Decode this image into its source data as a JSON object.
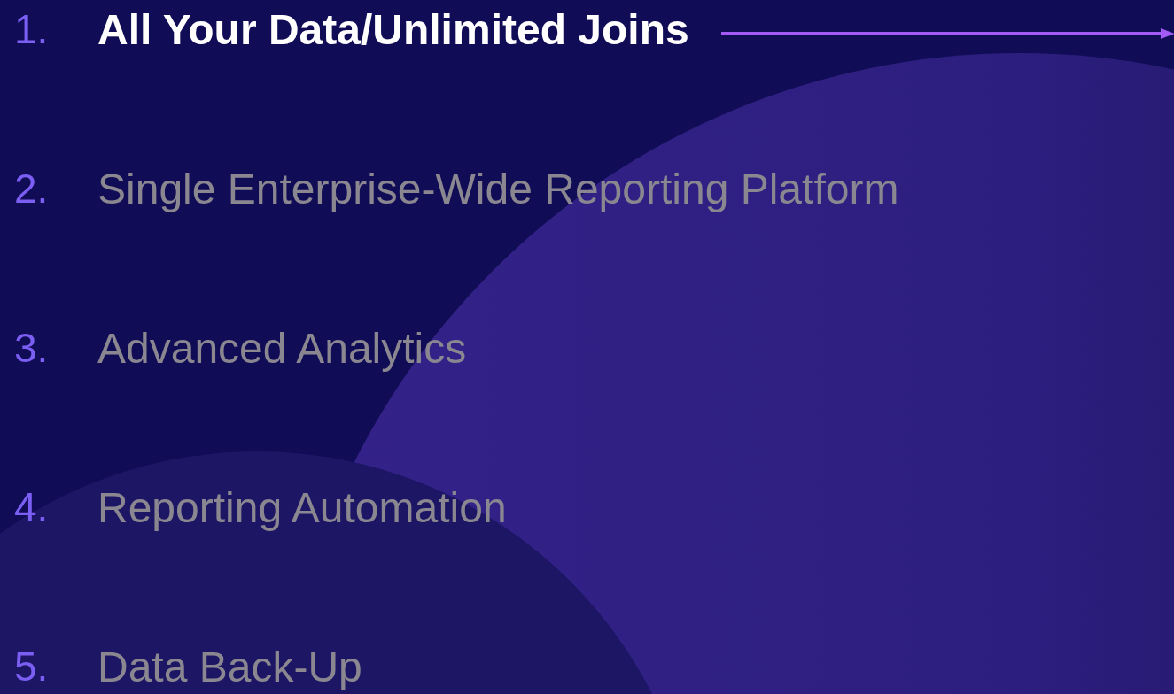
{
  "items": [
    {
      "number": "1.",
      "label": "All Your Data/Unlimited Joins",
      "selected": true
    },
    {
      "number": "2.",
      "label": "Single Enterprise-Wide Reporting Platform",
      "selected": false
    },
    {
      "number": "3.",
      "label": "Advanced Analytics",
      "selected": false
    },
    {
      "number": "4.",
      "label": "Reporting Automation",
      "selected": false
    },
    {
      "number": "5.",
      "label": "Data Back-Up",
      "selected": false
    }
  ]
}
